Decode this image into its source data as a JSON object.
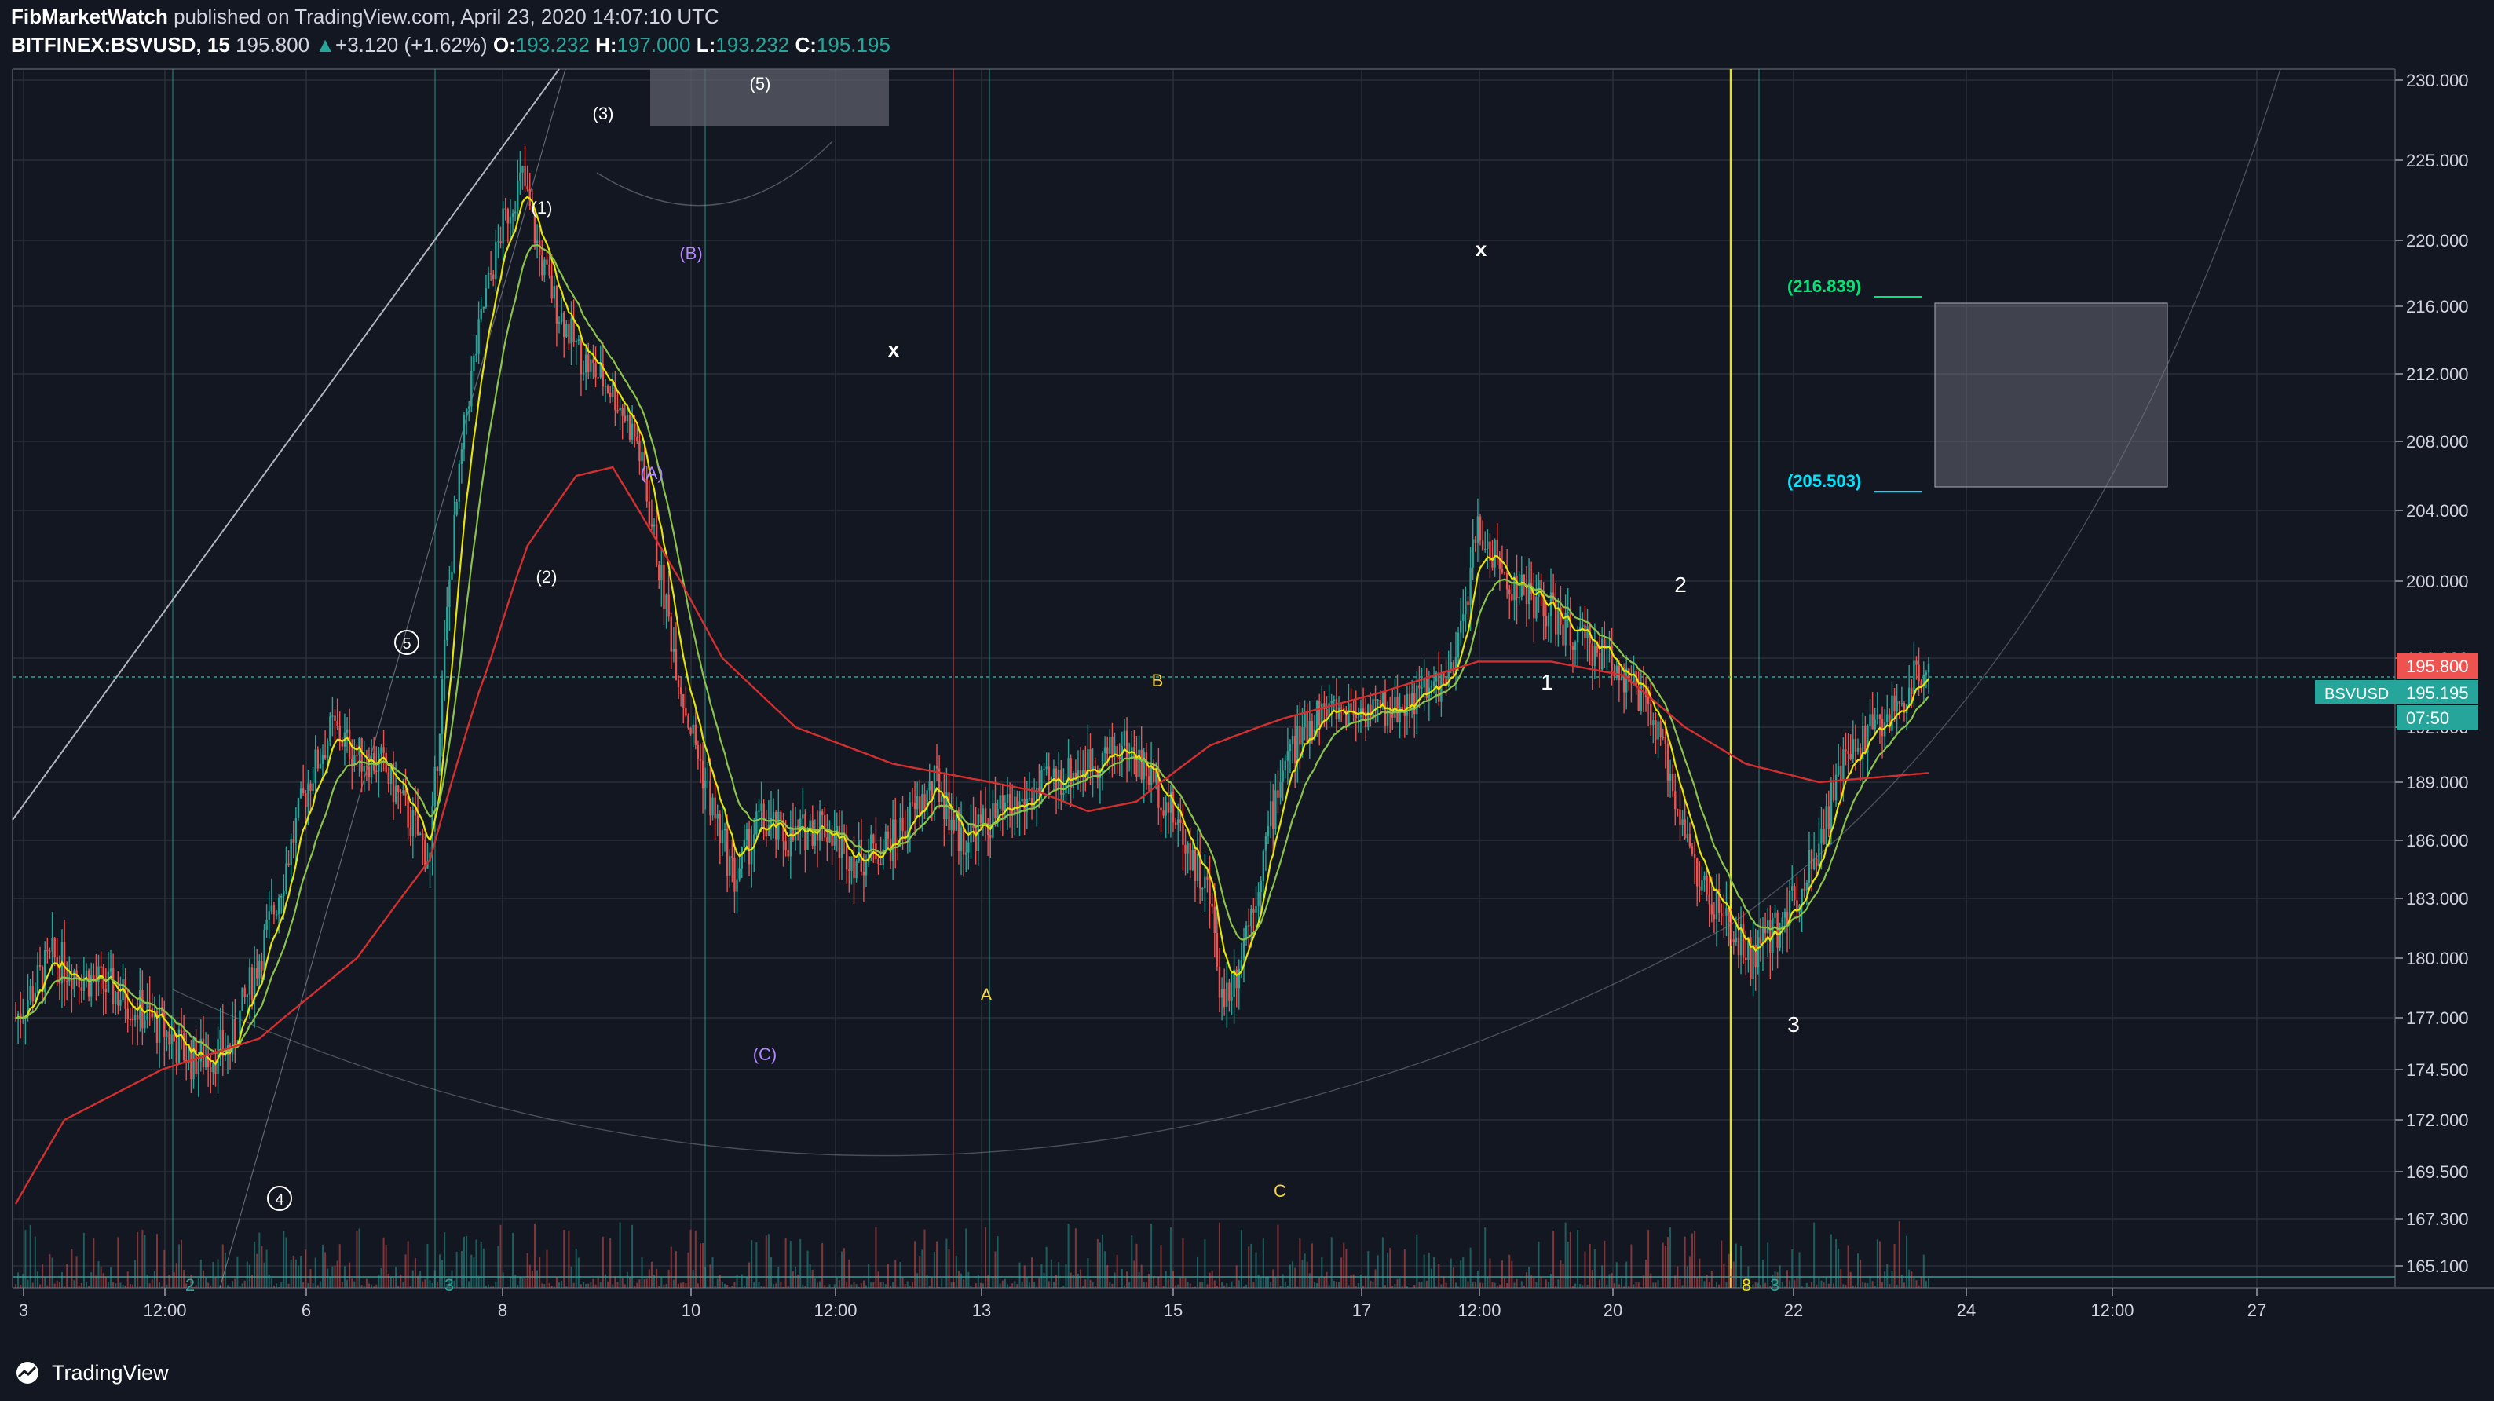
{
  "header": {
    "publisher": "FibMarketWatch",
    "published_text": "published on TradingView.com, April 23, 2020 14:07:10 UTC",
    "symbol": "BITFINEX:BSVUSD, 15",
    "last": "195.800",
    "change_arrow": "▲",
    "change": "+3.120 (+1.62%)",
    "o_label": "O:",
    "o_value": "193.232",
    "h_label": "H:",
    "h_value": "197.000",
    "l_label": "L:",
    "l_value": "193.232",
    "c_label": "C:",
    "c_value": "195.195"
  },
  "footer": {
    "brand": "TradingView"
  },
  "colors": {
    "background": "#131722",
    "grid": "#2a2e39",
    "up": "#26a69a",
    "down": "#ef5350",
    "ma_fast": "#e6e600",
    "ma_mid": "#8bc34a",
    "ma_slow": "#d32f2f",
    "price_line": "#26a69a",
    "cyan_level": "#00e5ff",
    "green_level": "#00e676",
    "purple_label": "#b388ff",
    "yellow_label": "#f5d547"
  },
  "chart_data": {
    "type": "candlestick",
    "symbol": "BITFINEX:BSVUSD",
    "interval": "15",
    "ylim": [
      164.5,
      231.5
    ],
    "y_ticks": [
      "230.000",
      "225.000",
      "220.000",
      "216.000",
      "212.000",
      "208.000",
      "204.000",
      "200.000",
      "196.000",
      "192.000",
      "189.000",
      "186.000",
      "183.000",
      "180.000",
      "177.000",
      "174.500",
      "172.000",
      "169.500",
      "167.300",
      "165.100"
    ],
    "x_ticks": [
      "3",
      "12:00",
      "6",
      "8",
      "10",
      "12:00",
      "13",
      "15",
      "17",
      "12:00",
      "20",
      "22",
      "24",
      "12:00",
      "27"
    ],
    "price_path": [
      [
        0,
        177
      ],
      [
        15,
        180
      ],
      [
        30,
        179
      ],
      [
        45,
        178
      ],
      [
        60,
        176.5
      ],
      [
        72,
        175
      ],
      [
        88,
        175.5
      ],
      [
        105,
        182
      ],
      [
        120,
        189
      ],
      [
        130,
        192
      ],
      [
        140,
        190.5
      ],
      [
        150,
        190
      ],
      [
        162,
        187
      ],
      [
        170,
        185
      ],
      [
        178,
        200
      ],
      [
        185,
        210
      ],
      [
        192,
        216
      ],
      [
        200,
        221
      ],
      [
        208,
        224
      ],
      [
        215,
        219
      ],
      [
        222,
        216
      ],
      [
        232,
        213
      ],
      [
        245,
        211
      ],
      [
        255,
        208
      ],
      [
        265,
        200
      ],
      [
        275,
        193
      ],
      [
        285,
        188
      ],
      [
        295,
        184
      ],
      [
        305,
        187
      ],
      [
        318,
        186
      ],
      [
        330,
        187
      ],
      [
        345,
        185
      ],
      [
        360,
        186
      ],
      [
        378,
        189
      ],
      [
        388,
        186
      ],
      [
        400,
        187
      ],
      [
        415,
        188
      ],
      [
        425,
        189
      ],
      [
        440,
        190
      ],
      [
        455,
        191
      ],
      [
        468,
        189
      ],
      [
        480,
        186
      ],
      [
        490,
        183
      ],
      [
        495,
        178
      ],
      [
        500,
        179
      ],
      [
        510,
        184
      ],
      [
        520,
        190
      ],
      [
        535,
        193
      ],
      [
        550,
        193
      ],
      [
        565,
        193
      ],
      [
        578,
        194
      ],
      [
        590,
        195
      ],
      [
        600,
        203
      ],
      [
        612,
        200
      ],
      [
        625,
        199
      ],
      [
        640,
        197
      ],
      [
        655,
        196
      ],
      [
        665,
        194
      ],
      [
        670,
        193
      ],
      [
        680,
        189
      ],
      [
        690,
        184
      ],
      [
        700,
        182
      ],
      [
        712,
        180
      ],
      [
        720,
        181
      ],
      [
        730,
        183
      ],
      [
        740,
        186
      ],
      [
        750,
        190
      ],
      [
        762,
        192
      ],
      [
        772,
        193
      ],
      [
        780,
        195
      ],
      [
        785,
        195.8
      ]
    ],
    "ma_slow_path": [
      [
        0,
        168
      ],
      [
        20,
        172
      ],
      [
        60,
        174.5
      ],
      [
        100,
        176
      ],
      [
        140,
        180
      ],
      [
        170,
        185
      ],
      [
        190,
        194
      ],
      [
        210,
        202
      ],
      [
        230,
        206
      ],
      [
        245,
        206.5
      ],
      [
        260,
        203
      ],
      [
        290,
        196
      ],
      [
        320,
        192
      ],
      [
        360,
        190
      ],
      [
        400,
        189
      ],
      [
        420,
        188.5
      ],
      [
        440,
        187.5
      ],
      [
        460,
        188
      ],
      [
        490,
        191
      ],
      [
        520,
        192.5
      ],
      [
        560,
        194
      ],
      [
        600,
        195.8
      ],
      [
        630,
        195.8
      ],
      [
        660,
        195
      ],
      [
        685,
        192
      ],
      [
        710,
        190
      ],
      [
        740,
        189
      ],
      [
        785,
        189.5
      ]
    ],
    "current_price": "195.800",
    "price_labels": {
      "last": "195.800",
      "symbol_tag": "BSVUSD",
      "close": "195.195",
      "countdown": "07:50"
    },
    "wave_labels_white": [
      "(5)",
      "(3)",
      "(1)",
      "(2)",
      "5",
      "4"
    ],
    "wave_labels_purple": [
      "(B)",
      "(A)",
      "(C)"
    ],
    "wave_labels_yellow": [
      "B",
      "A",
      "C"
    ],
    "wave_labels_count": [
      "1",
      "2",
      "3"
    ],
    "fib_levels": [
      {
        "label": "(216.839)",
        "value": 216.839,
        "color": "green"
      },
      {
        "label": "(205.503)",
        "value": 205.503,
        "color": "cyan"
      }
    ],
    "target_zone": [
      205.5,
      216.5
    ],
    "markers": [
      "x",
      "x"
    ],
    "bottom_labels": [
      "2",
      "3",
      "8",
      "3"
    ]
  }
}
